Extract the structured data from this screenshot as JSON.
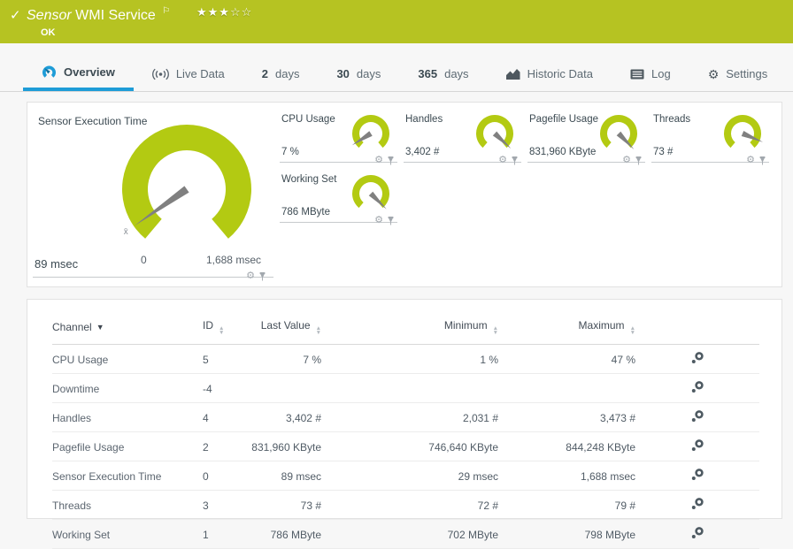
{
  "colors": {
    "green": "#b6c322",
    "gauge_green": "#b3ca12",
    "blue": "#1e9cd7",
    "needle": "#808080"
  },
  "header": {
    "check_icon": "check-icon",
    "type_label": "Sensor",
    "title": "WMI Service",
    "flag_icon": "flag-icon",
    "rating_filled": 3,
    "rating_total": 5,
    "status": "OK"
  },
  "tabs": [
    {
      "label": "Overview",
      "icon": "gauge-icon",
      "active": true
    },
    {
      "label": "Live Data",
      "icon": "live-data-icon"
    },
    {
      "strong": "2",
      "label": "days"
    },
    {
      "strong": "30",
      "label": "days"
    },
    {
      "strong": "365",
      "label": "days"
    },
    {
      "label": "Historic Data",
      "icon": "historic-data-icon"
    },
    {
      "label": "Log",
      "icon": "log-icon"
    },
    {
      "label": "Settings",
      "icon": "settings-gear-icon"
    }
  ],
  "gauges": {
    "main": {
      "title": "Sensor Execution Time",
      "value": "89 msec",
      "scale_min": "0",
      "scale_max": "1,688 msec",
      "mean_marker": "x̄",
      "needle_angle": 235
    },
    "small": [
      {
        "title": "CPU Usage",
        "value": "7 %",
        "needle_angle": 238
      },
      {
        "title": "Handles",
        "value": "3,402 #",
        "needle_angle": 133
      },
      {
        "title": "Pagefile Usage",
        "value": "831,960 KByte",
        "needle_angle": 136
      },
      {
        "title": "Threads",
        "value": "73 #",
        "needle_angle": 113
      },
      {
        "title": "Working Set",
        "value": "786 MByte",
        "needle_angle": 135
      }
    ]
  },
  "table": {
    "columns": [
      {
        "label": "Channel",
        "sort": "desc"
      },
      {
        "label": "ID",
        "sort": "both"
      },
      {
        "label": "Last Value",
        "sort": "both"
      },
      {
        "label": "Minimum",
        "sort": "both"
      },
      {
        "label": "Maximum",
        "sort": "both"
      }
    ],
    "rows": [
      {
        "channel": "CPU Usage",
        "id": "5",
        "last": "7 %",
        "min": "1 %",
        "max": "47 %"
      },
      {
        "channel": "Downtime",
        "id": "-4",
        "last": "",
        "min": "",
        "max": ""
      },
      {
        "channel": "Handles",
        "id": "4",
        "last": "3,402 #",
        "min": "2,031 #",
        "max": "3,473 #"
      },
      {
        "channel": "Pagefile Usage",
        "id": "2",
        "last": "831,960 KByte",
        "min": "746,640 KByte",
        "max": "844,248 KByte"
      },
      {
        "channel": "Sensor Execution Time",
        "id": "0",
        "last": "89 msec",
        "min": "29 msec",
        "max": "1,688 msec"
      },
      {
        "channel": "Threads",
        "id": "3",
        "last": "73 #",
        "min": "72 #",
        "max": "79 #"
      },
      {
        "channel": "Working Set",
        "id": "1",
        "last": "786 MByte",
        "min": "702 MByte",
        "max": "798 MByte"
      }
    ]
  }
}
